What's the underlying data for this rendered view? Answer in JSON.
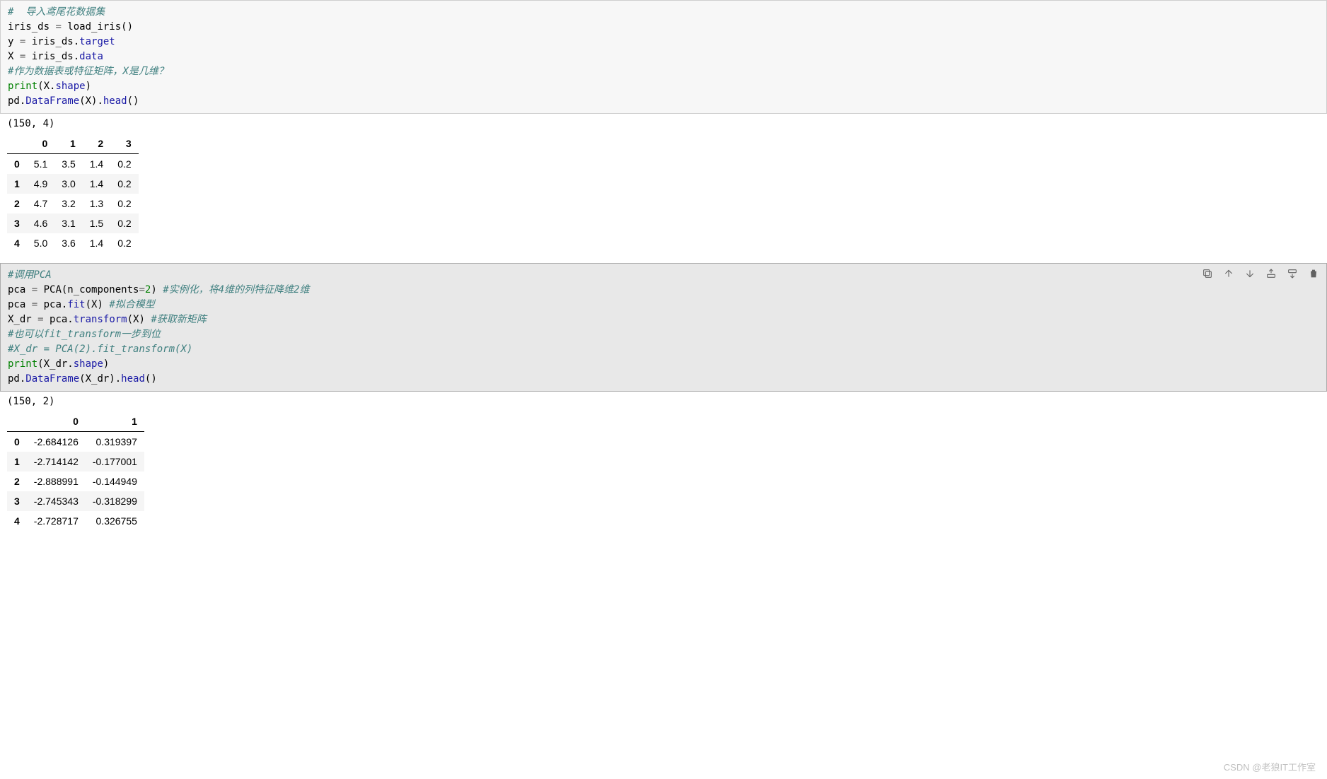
{
  "cell1": {
    "code": {
      "line1": "#  导入鸢尾花数据集",
      "line2a": "iris_ds ",
      "line2b": "=",
      "line2c": " load_iris()",
      "line3a": "y ",
      "line3b": "=",
      "line3c": " iris_ds.",
      "line3d": "target",
      "line4a": "X ",
      "line4b": "=",
      "line4c": " iris_ds.",
      "line4d": "data",
      "line5": "#作为数据表或特征矩阵，X是几维？",
      "line6a": "print",
      "line6b": "(X.",
      "line6c": "shape",
      "line6d": ")",
      "line7a": "pd.",
      "line7b": "DataFrame",
      "line7c": "(X).",
      "line7d": "head",
      "line7e": "()"
    },
    "output_text": "(150, 4)",
    "table": {
      "headers": [
        "0",
        "1",
        "2",
        "3"
      ],
      "rows": [
        {
          "idx": "0",
          "vals": [
            "5.1",
            "3.5",
            "1.4",
            "0.2"
          ]
        },
        {
          "idx": "1",
          "vals": [
            "4.9",
            "3.0",
            "1.4",
            "0.2"
          ]
        },
        {
          "idx": "2",
          "vals": [
            "4.7",
            "3.2",
            "1.3",
            "0.2"
          ]
        },
        {
          "idx": "3",
          "vals": [
            "4.6",
            "3.1",
            "1.5",
            "0.2"
          ]
        },
        {
          "idx": "4",
          "vals": [
            "5.0",
            "3.6",
            "1.4",
            "0.2"
          ]
        }
      ]
    }
  },
  "cell2": {
    "code": {
      "line1": "#调用PCA",
      "line2a": "pca ",
      "line2b": "=",
      "line2c": " PCA(n_components",
      "line2d": "=",
      "line2e": "2",
      "line2f": ") ",
      "line2g": "#实例化，将4维的列特征降维2维",
      "line3a": "pca ",
      "line3b": "=",
      "line3c": " pca.",
      "line3d": "fit",
      "line3e": "(X) ",
      "line3f": "#拟合模型",
      "line4a": "X_dr ",
      "line4b": "=",
      "line4c": " pca.",
      "line4d": "transform",
      "line4e": "(X) ",
      "line4f": "#获取新矩阵",
      "line5": "#也可以fit_transform一步到位",
      "line6": "#X_dr = PCA(2).fit_transform(X)",
      "line7a": "print",
      "line7b": "(X_dr.",
      "line7c": "shape",
      "line7d": ")",
      "line8a": "pd.",
      "line8b": "DataFrame",
      "line8c": "(X_dr).",
      "line8d": "head",
      "line8e": "()"
    },
    "output_text": "(150, 2)",
    "table": {
      "headers": [
        "0",
        "1"
      ],
      "rows": [
        {
          "idx": "0",
          "vals": [
            "-2.684126",
            "0.319397"
          ]
        },
        {
          "idx": "1",
          "vals": [
            "-2.714142",
            "-0.177001"
          ]
        },
        {
          "idx": "2",
          "vals": [
            "-2.888991",
            "-0.144949"
          ]
        },
        {
          "idx": "3",
          "vals": [
            "-2.745343",
            "-0.318299"
          ]
        },
        {
          "idx": "4",
          "vals": [
            "-2.728717",
            "0.326755"
          ]
        }
      ]
    }
  },
  "watermark": "CSDN @老狼IT工作室"
}
